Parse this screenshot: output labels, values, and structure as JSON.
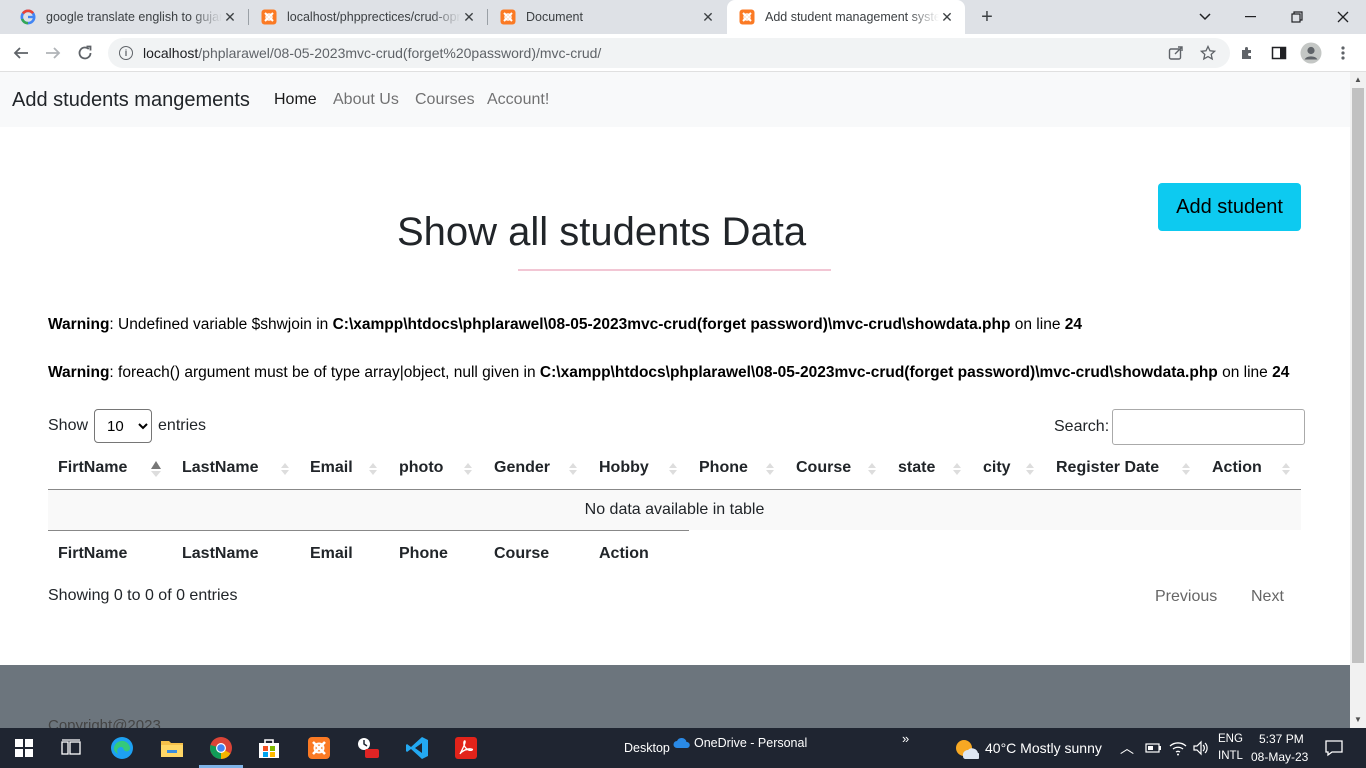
{
  "browser": {
    "tabs": [
      {
        "title": "google translate english to gujarati",
        "icon": "google-icon"
      },
      {
        "title": "localhost/phpprectices/crud-opration",
        "icon": "xampp-icon"
      },
      {
        "title": "Document",
        "icon": "xampp-icon"
      },
      {
        "title": "Add student management system",
        "icon": "xampp-icon",
        "active": true
      }
    ],
    "url_host": "localhost",
    "url_path": "/phplarawel/08-05-2023mvc-crud(forget%20password)/mvc-crud/"
  },
  "navbar": {
    "brand": "Add students mangements",
    "links": [
      "Home",
      "About Us",
      "Courses",
      "Account!"
    ]
  },
  "page": {
    "add_button": "Add student",
    "title": "Show all students Data"
  },
  "warnings": [
    {
      "label": "Warning",
      "message": ": Undefined variable $shwjoin in ",
      "file": "C:\\xampp\\htdocs\\phplarawel\\08-05-2023mvc-crud(forget password)\\mvc-crud\\showdata.php",
      "on_line": " on line ",
      "line": "24"
    },
    {
      "label": "Warning",
      "message": ": foreach() argument must be of type array|object, null given in ",
      "file": "C:\\xampp\\htdocs\\phplarawel\\08-05-2023mvc-crud(forget password)\\mvc-crud\\showdata.php",
      "on_line": " on line ",
      "line": "24"
    }
  ],
  "datatable": {
    "show_label": "Show",
    "page_length": "10",
    "entries_label": "entries",
    "search_label": "Search:",
    "search_value": "",
    "columns": [
      "FirtName",
      "LastName",
      "Email",
      "photo",
      "Gender",
      "Hobby",
      "Phone",
      "Course",
      "state",
      "city",
      "Register Date",
      "Action"
    ],
    "empty_message": "No data available in table",
    "footer_columns": [
      "FirtName",
      "LastName",
      "Email",
      "Phone",
      "Course",
      "Action"
    ],
    "info": "Showing 0 to 0 of 0 entries",
    "previous": "Previous",
    "next": "Next"
  },
  "footer": {
    "text": "Copyright@2023"
  },
  "taskbar": {
    "desktop_label": "Desktop",
    "onedrive_label": "OneDrive - Personal",
    "weather": "40°C  Mostly sunny",
    "lang_top": "ENG",
    "lang_bottom": "INTL",
    "time": "5:37 PM",
    "date": "08-May-23"
  }
}
